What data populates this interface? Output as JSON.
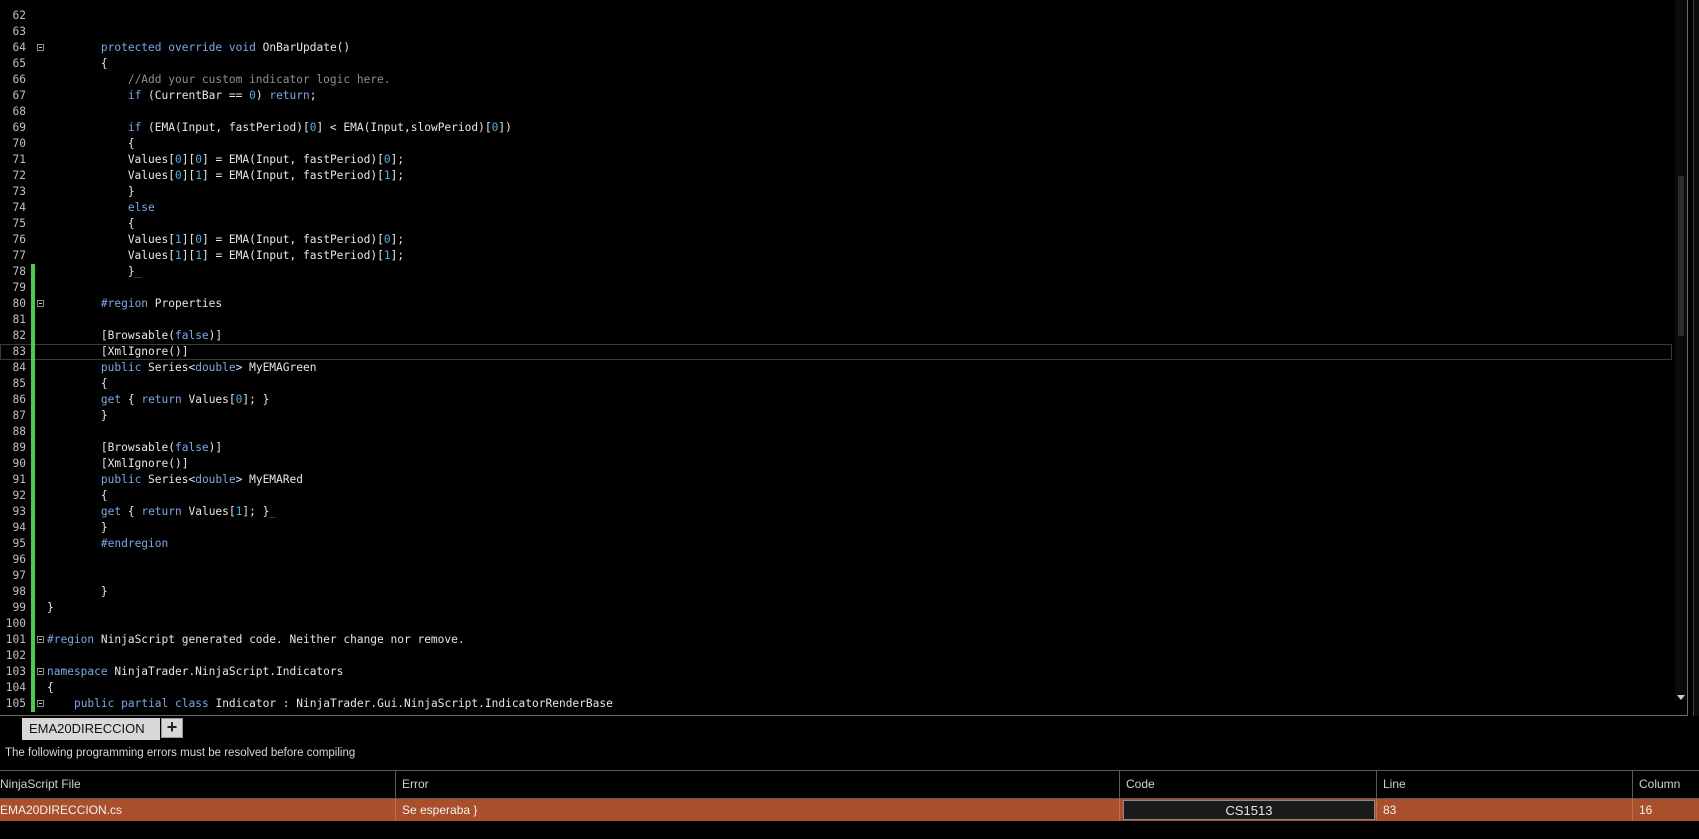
{
  "editor": {
    "lines": [
      {
        "n": "62",
        "html": ""
      },
      {
        "n": "63",
        "html": ""
      },
      {
        "n": "64",
        "fold": true,
        "html": "        <span class=\"kw\">protected</span> <span class=\"kw\">override</span> <span class=\"kw\">void</span> OnBarUpdate()"
      },
      {
        "n": "65",
        "html": "        {"
      },
      {
        "n": "66",
        "html": "            <span class=\"cmt\">//Add your custom indicator logic here.</span>"
      },
      {
        "n": "67",
        "html": "            <span class=\"kw\">if</span> (CurrentBar == <span class=\"num\">0</span>) <span class=\"kw\">return</span>;"
      },
      {
        "n": "68",
        "html": ""
      },
      {
        "n": "69",
        "html": "            <span class=\"kw\">if</span> (EMA(Input, fastPeriod)[<span class=\"num\">0</span>] &lt; EMA(Input,slowPeriod)[<span class=\"num\">0</span>])"
      },
      {
        "n": "70",
        "html": "            {"
      },
      {
        "n": "71",
        "html": "            Values[<span class=\"num\">0</span>][<span class=\"num\">0</span>] = EMA(Input, fastPeriod)[<span class=\"num\">0</span>];"
      },
      {
        "n": "72",
        "html": "            Values[<span class=\"num\">0</span>][<span class=\"num\">1</span>] = EMA(Input, fastPeriod)[<span class=\"num\">1</span>];"
      },
      {
        "n": "73",
        "html": "            }"
      },
      {
        "n": "74",
        "html": "            <span class=\"kw\">else</span>"
      },
      {
        "n": "75",
        "html": "            {"
      },
      {
        "n": "76",
        "html": "            Values[<span class=\"num\">1</span>][<span class=\"num\">0</span>] = EMA(Input, fastPeriod)[<span class=\"num\">0</span>];"
      },
      {
        "n": "77",
        "html": "            Values[<span class=\"num\">1</span>][<span class=\"num\">1</span>] = EMA(Input, fastPeriod)[<span class=\"num\">1</span>];"
      },
      {
        "n": "78",
        "changed": true,
        "html": "            }<span class=\"caret\">_</span>"
      },
      {
        "n": "79",
        "changed": true,
        "html": ""
      },
      {
        "n": "80",
        "changed": true,
        "fold": true,
        "html": "        <span class=\"kw\">#region</span> Properties"
      },
      {
        "n": "81",
        "changed": true,
        "html": ""
      },
      {
        "n": "82",
        "changed": true,
        "html": "        [Browsable(<span class=\"kw\">false</span>)]"
      },
      {
        "n": "83",
        "changed": true,
        "current": true,
        "html": "        [XmlIgnore()]"
      },
      {
        "n": "84",
        "changed": true,
        "html": "        <span class=\"kw\">public</span> Series&lt;<span class=\"kw\">double</span>&gt; MyEMAGreen"
      },
      {
        "n": "85",
        "changed": true,
        "html": "        {"
      },
      {
        "n": "86",
        "changed": true,
        "html": "        <span class=\"kw\">get</span> { <span class=\"kw\">return</span> Values[<span class=\"num\">0</span>]; }"
      },
      {
        "n": "87",
        "changed": true,
        "html": "        }"
      },
      {
        "n": "88",
        "changed": true,
        "html": ""
      },
      {
        "n": "89",
        "changed": true,
        "html": "        [Browsable(<span class=\"kw\">false</span>)]"
      },
      {
        "n": "90",
        "changed": true,
        "html": "        [XmlIgnore()]"
      },
      {
        "n": "91",
        "changed": true,
        "html": "        <span class=\"kw\">public</span> Series&lt;<span class=\"kw\">double</span>&gt; MyEMARed"
      },
      {
        "n": "92",
        "changed": true,
        "html": "        {"
      },
      {
        "n": "93",
        "changed": true,
        "html": "        <span class=\"kw\">get</span> { <span class=\"kw\">return</span> Values[<span class=\"num\">1</span>]; }<span class=\"caret\">_</span>"
      },
      {
        "n": "94",
        "changed": true,
        "html": "        }"
      },
      {
        "n": "95",
        "changed": true,
        "html": "        <span class=\"kw\">#endregion</span>"
      },
      {
        "n": "96",
        "changed": true,
        "html": ""
      },
      {
        "n": "97",
        "changed": true,
        "html": ""
      },
      {
        "n": "98",
        "changed": true,
        "html": "        }"
      },
      {
        "n": "99",
        "changed": true,
        "html": "}"
      },
      {
        "n": "100",
        "changed": true,
        "html": ""
      },
      {
        "n": "101",
        "changed": true,
        "fold": true,
        "html": "<span class=\"kw\">#region</span> NinjaScript generated code. Neither change nor remove."
      },
      {
        "n": "102",
        "changed": true,
        "html": ""
      },
      {
        "n": "103",
        "changed": true,
        "fold": true,
        "html": "<span class=\"kw\">namespace</span> NinjaTrader.NinjaScript.Indicators"
      },
      {
        "n": "104",
        "changed": true,
        "html": "{"
      },
      {
        "n": "105",
        "changed": true,
        "fold": true,
        "html": "    <span class=\"kw\">public</span> <span class=\"kw\">partial</span> <span class=\"kw\">class</span> Indicator : NinjaTrader.Gui.NinjaScript.IndicatorRenderBase"
      }
    ]
  },
  "tabs": {
    "active_label": "EMA20DIRECCION",
    "add_label": "+"
  },
  "errors": {
    "message": "The following programming errors must be resolved before compiling",
    "headers": {
      "file": "NinjaScript File",
      "error": "Error",
      "code": "Code",
      "line": "Line",
      "column": "Column"
    },
    "rows": [
      {
        "file": "EMA20DIRECCION.cs",
        "error": "Se esperaba }",
        "code": "CS1513",
        "line": "83",
        "column": "16"
      }
    ]
  },
  "colors": {
    "error_row": "#a94f2b",
    "gutter_changed": "#4fc94b",
    "keyword": "#7aa7e6",
    "number": "#4fb0e6"
  }
}
